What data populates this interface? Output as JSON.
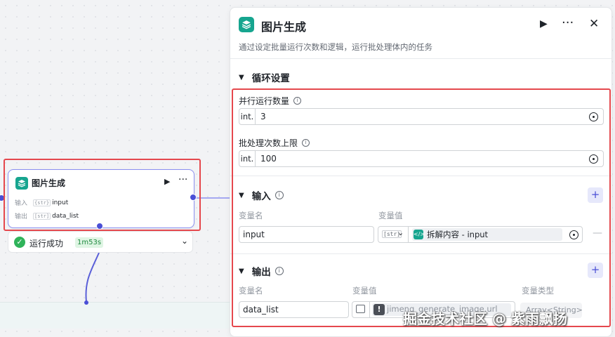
{
  "node": {
    "title": "图片生成",
    "input_label": "输入",
    "input_type": "{str}",
    "input_value": "input",
    "output_label": "输出",
    "output_type": "[str]",
    "output_value": "data_list",
    "status_text": "运行成功",
    "status_time": "1m53s"
  },
  "panel": {
    "title": "图片生成",
    "description": "通过设定批量运行次数和逻辑，运行批处理体内的任务",
    "loop_section": {
      "title": "循环设置",
      "concurrency_label": "并行运行数量",
      "concurrency_type": "int.",
      "concurrency_value": "3",
      "batch_limit_label": "批处理次数上限",
      "batch_limit_type": "int.",
      "batch_limit_value": "100"
    },
    "input_section": {
      "title": "输入",
      "col_name": "变量名",
      "col_value": "变量值",
      "var_name": "input",
      "var_type": "[str]",
      "ref_text": "拆解内容 - input"
    },
    "output_section": {
      "title": "输出",
      "col_name": "变量名",
      "col_value": "变量值",
      "col_type": "变量类型",
      "var_name": "data_list",
      "ref_text": "jimeng_generate_image.url",
      "type_value": "Array<String>"
    }
  },
  "watermark": "掘金技术社区 @ 紫雨飘扬",
  "colors": {
    "accent": "#4a4fd6",
    "brand_icon": "#16a58f",
    "annotation_red": "#e5484d",
    "success": "#2fb35a"
  }
}
